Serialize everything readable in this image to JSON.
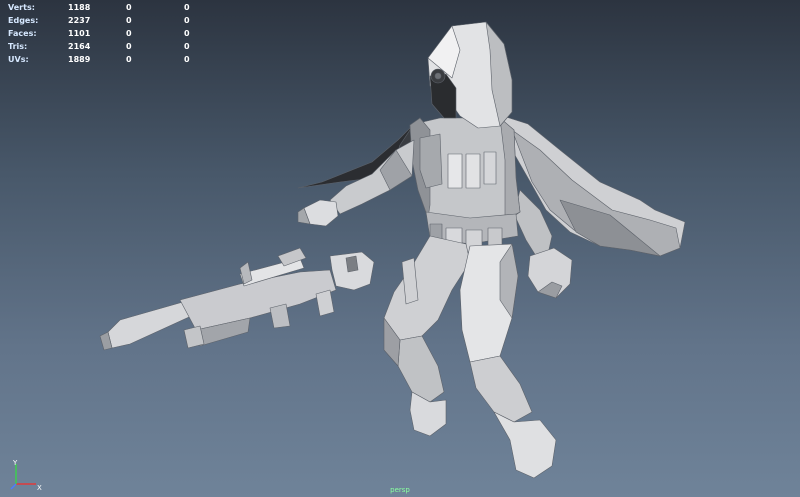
{
  "hud": {
    "rows": [
      {
        "label": "Verts:",
        "v1": "1188",
        "v2": "0",
        "v3": "0"
      },
      {
        "label": "Edges:",
        "v1": "2237",
        "v2": "0",
        "v3": "0"
      },
      {
        "label": "Faces:",
        "v1": "1101",
        "v2": "0",
        "v3": "0"
      },
      {
        "label": "Tris:",
        "v1": "2164",
        "v2": "0",
        "v3": "0"
      },
      {
        "label": "UVs:",
        "v1": "1889",
        "v2": "0",
        "v3": "0"
      }
    ]
  },
  "axis": {
    "y": "Y",
    "x": "X"
  },
  "camera": {
    "name": "persp"
  },
  "colors": {
    "x_axis": "#e03a3a",
    "y_axis": "#3ad34a",
    "z_axis": "#4a7dff",
    "label_green": "#88ffa0"
  }
}
